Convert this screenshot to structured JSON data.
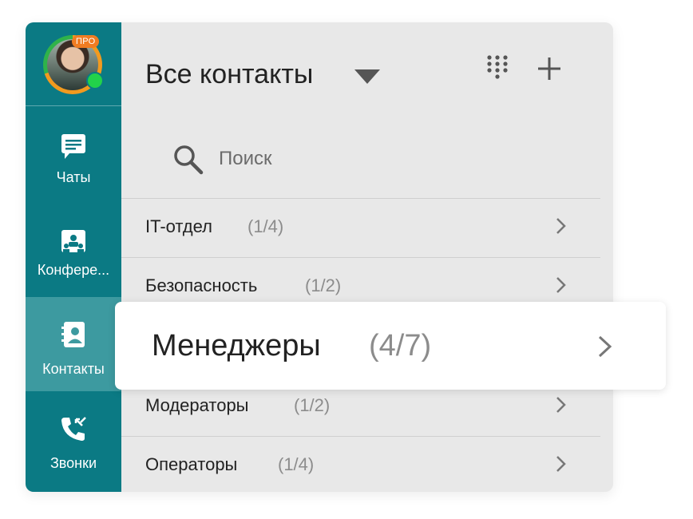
{
  "colors": {
    "sidebar": "#0b7a84",
    "sidebar_active": "#3d9aa0",
    "accent_orange": "#f07c22",
    "online_green": "#22d24a",
    "panel_bg": "#e8e8e8"
  },
  "profile": {
    "badge": "ПРО",
    "status": "online"
  },
  "sidebar": {
    "items": [
      {
        "label": "Чаты",
        "icon": "chat-icon",
        "active": false
      },
      {
        "label": "Конфере...",
        "icon": "conference-icon",
        "active": false
      },
      {
        "label": "Контакты",
        "icon": "contacts-icon",
        "active": true
      },
      {
        "label": "Звонки",
        "icon": "calls-icon",
        "active": false
      }
    ]
  },
  "header": {
    "title": "Все контакты",
    "dropdown_icon": "caret-down-icon",
    "dialpad_icon": "dialpad-icon",
    "add_icon": "plus-icon"
  },
  "search": {
    "placeholder": "Поиск",
    "value": "",
    "icon": "search-icon"
  },
  "groups": [
    {
      "name": "IT-отдел",
      "count": "(1/4)"
    },
    {
      "name": "Безопасность",
      "count": "(1/2)"
    },
    {
      "name": "Менеджеры",
      "count": "(4/7)",
      "highlighted": true
    },
    {
      "name": "Модераторы",
      "count": "(1/2)"
    },
    {
      "name": "Операторы",
      "count": "(1/4)"
    }
  ]
}
